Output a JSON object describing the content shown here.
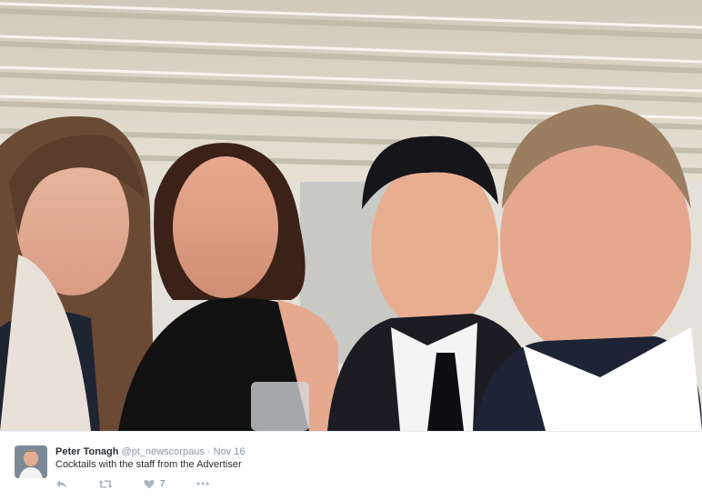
{
  "tweet": {
    "author_name": "Peter Tonagh",
    "handle": "@pt_newscorpaus",
    "separator": "·",
    "date": "Nov 16",
    "text": "Cocktails with the staff from the Advertiser",
    "likes_count": "7"
  },
  "icons": [
    "reply-icon",
    "retweet-icon",
    "heart-icon",
    "more-icon"
  ],
  "colors": {
    "text": "#292f33",
    "muted": "#8899a6",
    "icon": "#aab8c2"
  }
}
